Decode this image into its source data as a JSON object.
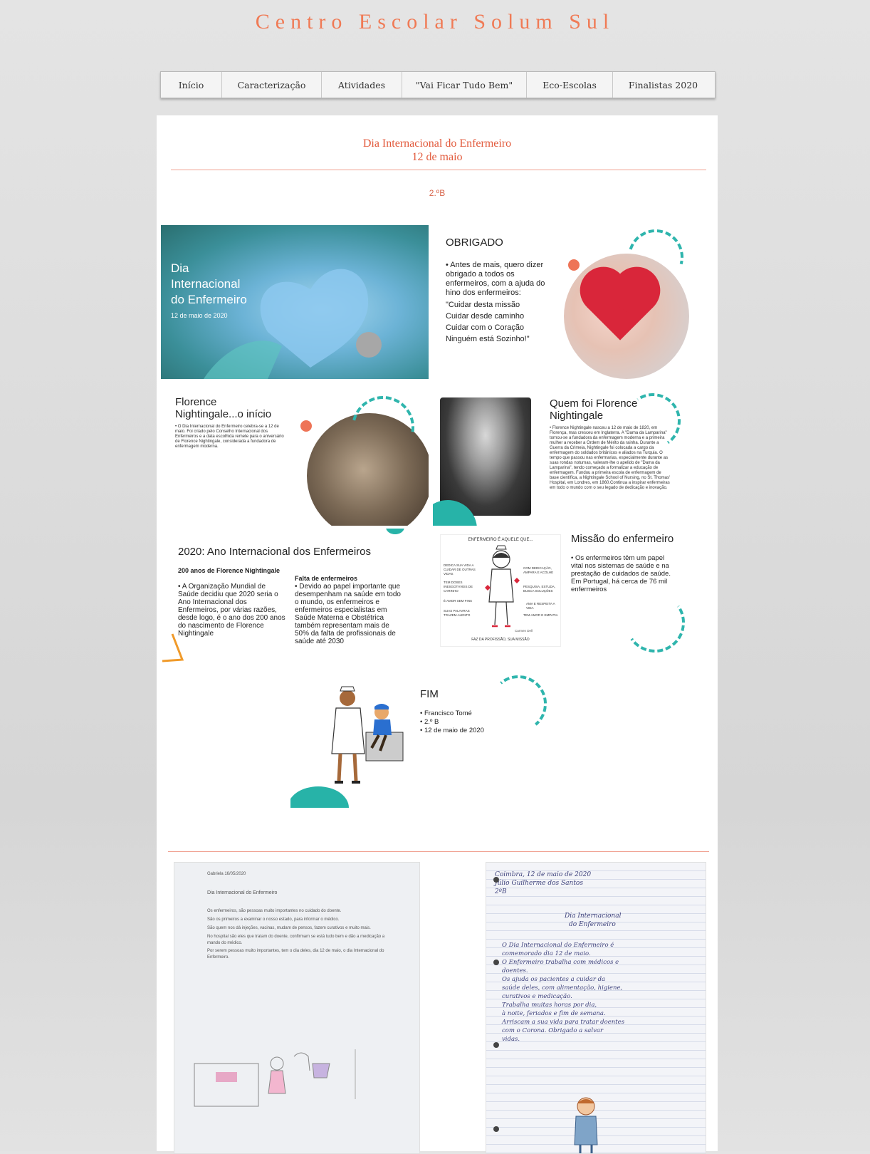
{
  "site": {
    "title": "Centro Escolar Solum Sul"
  },
  "nav": {
    "items": [
      "Início",
      "Caracterização",
      "Atividades",
      "\"Vai Ficar Tudo Bem\"",
      "Eco-Escolas",
      "Finalistas 2020"
    ]
  },
  "post": {
    "title_line1": "Dia Internacional do Enfermeiro",
    "title_line2": "12 de maio",
    "class_label": "2.ºB"
  },
  "slides": {
    "cover": {
      "title_l1": "Dia",
      "title_l2": "Internacional",
      "title_l3": "do Enfermeiro",
      "date": "12 de maio de 2020"
    },
    "obrigado": {
      "title": "OBRIGADO",
      "bullet": "• Antes de mais, quero dizer obrigado a todos os enfermeiros, com a ajuda do hino dos enfermeiros:",
      "verse1": "\"Cuidar desta missão",
      "verse2": "Cuidar desde caminho",
      "verse3": "Cuidar com o Coração",
      "verse4": "Ninguém está Sozinho!\""
    },
    "inicio": {
      "title_l1": "Florence",
      "title_l2": "Nightingale...o início",
      "text": "• O Dia Internacional do Enfermeiro celebra-se a 12 de maio. Foi criado pelo Conselho Internacional dos Enfermeiros e a data escolhida remete para o aniversário de Florence Nightingale, considerada a fundadora de enfermagem moderna."
    },
    "quem": {
      "title_l1": "Quem foi Florence",
      "title_l2": "Nightingale",
      "text": "• Florence Nightingale nasceu a 12 de maio de 1820, em Florença, mas cresceu em Inglaterra. A \"Dama da Lamparina\" tornou-se a fundadora da enfermagem moderna e a primeira mulher a receber a Ordem de Mérito da rainha. Durante a Guerra da Crimeia, Nightingale foi colocada a cargo da enfermagem do soldados britânicos e aliados na Turquia. O tempo que passou nas enfermarias, especialmente durante as suas rondas noturnas, valeram-lhe o apelido de \"Dama da Lamparina\", tendo começado a formalizar a educação de enfermagem. Fundou a primeira escola de enfermagem de base científica, a Nightingale School of Nursing, no St. Thomas' Hospital, em Londres, em 1860.Continua a inspirar enfermeiras em todo o mundo com o seu legado de dedicação e inovação."
    },
    "ano": {
      "title": "2020: Ano Internacional dos Enfermeiros",
      "col1_heading": "200 anos de Florence Nightingale",
      "col1_text": "• A Organização Mundial de Saúde decidiu que 2020 seria o Ano Internacional dos Enfermeiros, por várias razões, desde logo, é o ano dos 200 anos do nascimento de Florence Nightingale",
      "col2_heading": "Falta de enfermeiros",
      "col2_text": "• Devido ao papel importante que desempenham na saúde em todo o mundo, os enfermeiros e enfermeiros especialistas em Saúde Materna e Obstétrica também representam mais de 50% da falta de profissionais de saúde até 2030"
    },
    "missao": {
      "title": "Missão do enfermeiro",
      "text": "• Os enfermeiros têm um papel vital nos sistemas de saúde e na prestação de cuidados de saúde. Em Portugal, há cerca de 76 mil enfermeiros",
      "cartoon_header": "ENFERMEIRO É AQUELE QUE...",
      "cartoon_l1": "DEDICA SUA VIDA A CUIDAR DE OUTRAS VIDAS",
      "cartoon_l2": "TEM DOSES INESGOTÁVEIS DE CARINHO",
      "cartoon_l3": "É AMOR SEM FINS",
      "cartoon_l4": "SUAS PALAVRAS TRAZEM ALENTO",
      "cartoon_r1": "COM DEDICAÇÃO, AMPARA E ACOLHE",
      "cartoon_r2": "PESQUISA, ESTUDA, BUSCA SOLUÇÕES",
      "cartoon_r3": "AMA E RESPEITA A VIDA",
      "cartoon_r4": "TEM AMOR E EMPATIA",
      "cartoon_footer": "FAZ DA PROFISSÃO, SUA MISSÃO",
      "cartoon_signature": "Carmen Dell"
    },
    "fim": {
      "title": "FIM",
      "items": [
        "• Francisco Tomé",
        "• 2.º B",
        "• 12 de maio de 2020"
      ]
    }
  },
  "student_pages": {
    "typed": {
      "header": "Gabriela 16/05/2020",
      "title": "Dia Internacional do Enfermeiro",
      "lines": [
        "Os enfermeiros, são pessoas muito importantes no cuidado do doente.",
        "São os primeiros a examinar o nosso estado, para informar o médico.",
        "São quem nos dá injeções, vacinas, mudam de pensos, fazem curativos e muito mais.",
        "No hospital são eles que tratam do doente, confirmam se está tudo bem e dão a medicação a mando do médico.",
        "Por serem pessoas muito importantes, tem o dia deles, dia 12 de maio, o dia Internacional do Enfermeiro."
      ]
    },
    "handwritten": {
      "line1": "Coimbra, 12 de maio de 2020",
      "line2": "Júlio Guilherme dos Santos",
      "line3": "2ºB",
      "title_l1": "Dia Internacional",
      "title_l2": "do Enfermeiro",
      "body": [
        "O Dia Internacional do Enfermeiro é",
        "comemorado dia 12 de maio.",
        "O Enfermeiro trabalha com médicos e",
        "doentes.",
        "Os ajuda os pacientes a cuidar da",
        "saúde deles, com alimentação, higiene,",
        "curativos e medicação.",
        "Trabalha muitas horas por dia,",
        "à noite, feriados e fim de semana.",
        "Arriscam a sua vida para tratar doentes",
        "com o Corona. Obrigado a salvar",
        "vidas."
      ]
    }
  },
  "colors": {
    "accent": "#f07a55",
    "teal": "#2fb5ad",
    "coral": "#ee7457"
  }
}
